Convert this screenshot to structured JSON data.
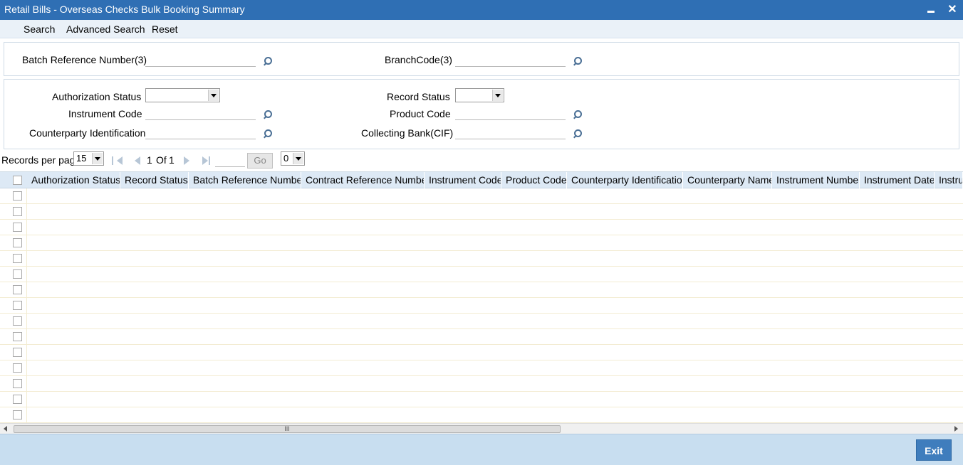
{
  "window": {
    "title": "Retail Bills - Overseas Checks Bulk Booking Summary",
    "minimize_icon": "minimize-icon",
    "close_glyph": "✕"
  },
  "toolbar": {
    "search": "Search",
    "advanced_search": "Advanced Search",
    "reset": "Reset"
  },
  "query": {
    "batch_reference_number_label": "Batch Reference Number(3)",
    "branch_code_label": "BranchCode(3)"
  },
  "filters": {
    "authorization_status_label": "Authorization Status",
    "record_status_label": "Record Status",
    "instrument_code_label": "Instrument Code",
    "product_code_label": "Product Code",
    "counterparty_identification_label": "Counterparty Identification",
    "collecting_bank_label": "Collecting Bank(CIF)",
    "authorization_status_value": "",
    "record_status_value": ""
  },
  "pager": {
    "records_per_page_label": "Records per page",
    "records_per_page_value": "15",
    "current_page": "1",
    "of_label": "Of",
    "total_pages": "1",
    "go_label": "Go",
    "page_select_value": "0"
  },
  "grid": {
    "columns": [
      "Authorization Status",
      "Record Status",
      "Batch Reference Number",
      "Contract Reference Number",
      "Instrument Code",
      "Product Code",
      "Counterparty Identification",
      "Counterparty Name",
      "Instrument Number",
      "Instrument Date",
      "Instru"
    ],
    "row_count": 15
  },
  "scrollbar": {
    "grip": "III"
  },
  "footer": {
    "exit_label": "Exit"
  }
}
